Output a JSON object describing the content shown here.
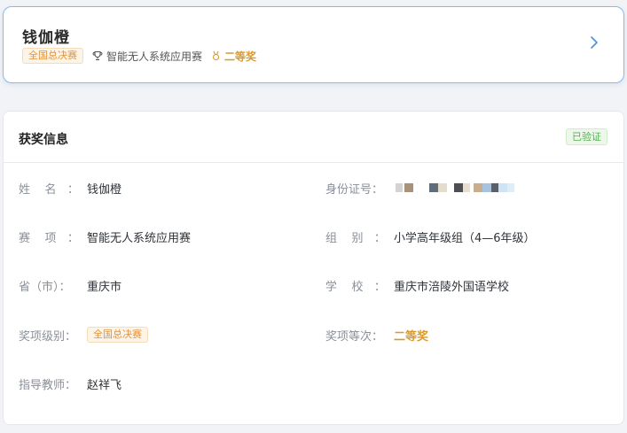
{
  "top": {
    "name": "钱伽橙",
    "level_tag": "全国总决赛",
    "competition": "智能无人系统应用赛",
    "award": "二等奖"
  },
  "info": {
    "title": "获奖信息",
    "verified": "已验证",
    "name_label": "姓    名   ：",
    "name_value": "钱伽橙",
    "id_label": "身份证号：",
    "event_label": "赛    项   ：",
    "event_value": "智能无人系统应用赛",
    "group_label": "组    别   ：",
    "group_value": "小学高年级组（4—6年级）",
    "province_label": "省（市）：",
    "province_value": "重庆市",
    "school_label": "学    校   ：",
    "school_value": "重庆市涪陵外国语学校",
    "level_label": "奖项级别：",
    "level_value": "全国总决赛",
    "rank_label": "奖项等次：",
    "rank_value": "二等奖",
    "teacher_label": "指导教师：",
    "teacher_value": "赵祥飞"
  },
  "colors": {
    "accent": "#4a90e2",
    "award": "#d99a2b",
    "tag": "#e2933b",
    "verified": "#52b152"
  },
  "icons": [
    "trophy-icon",
    "medal-icon",
    "chevron-right-icon"
  ]
}
